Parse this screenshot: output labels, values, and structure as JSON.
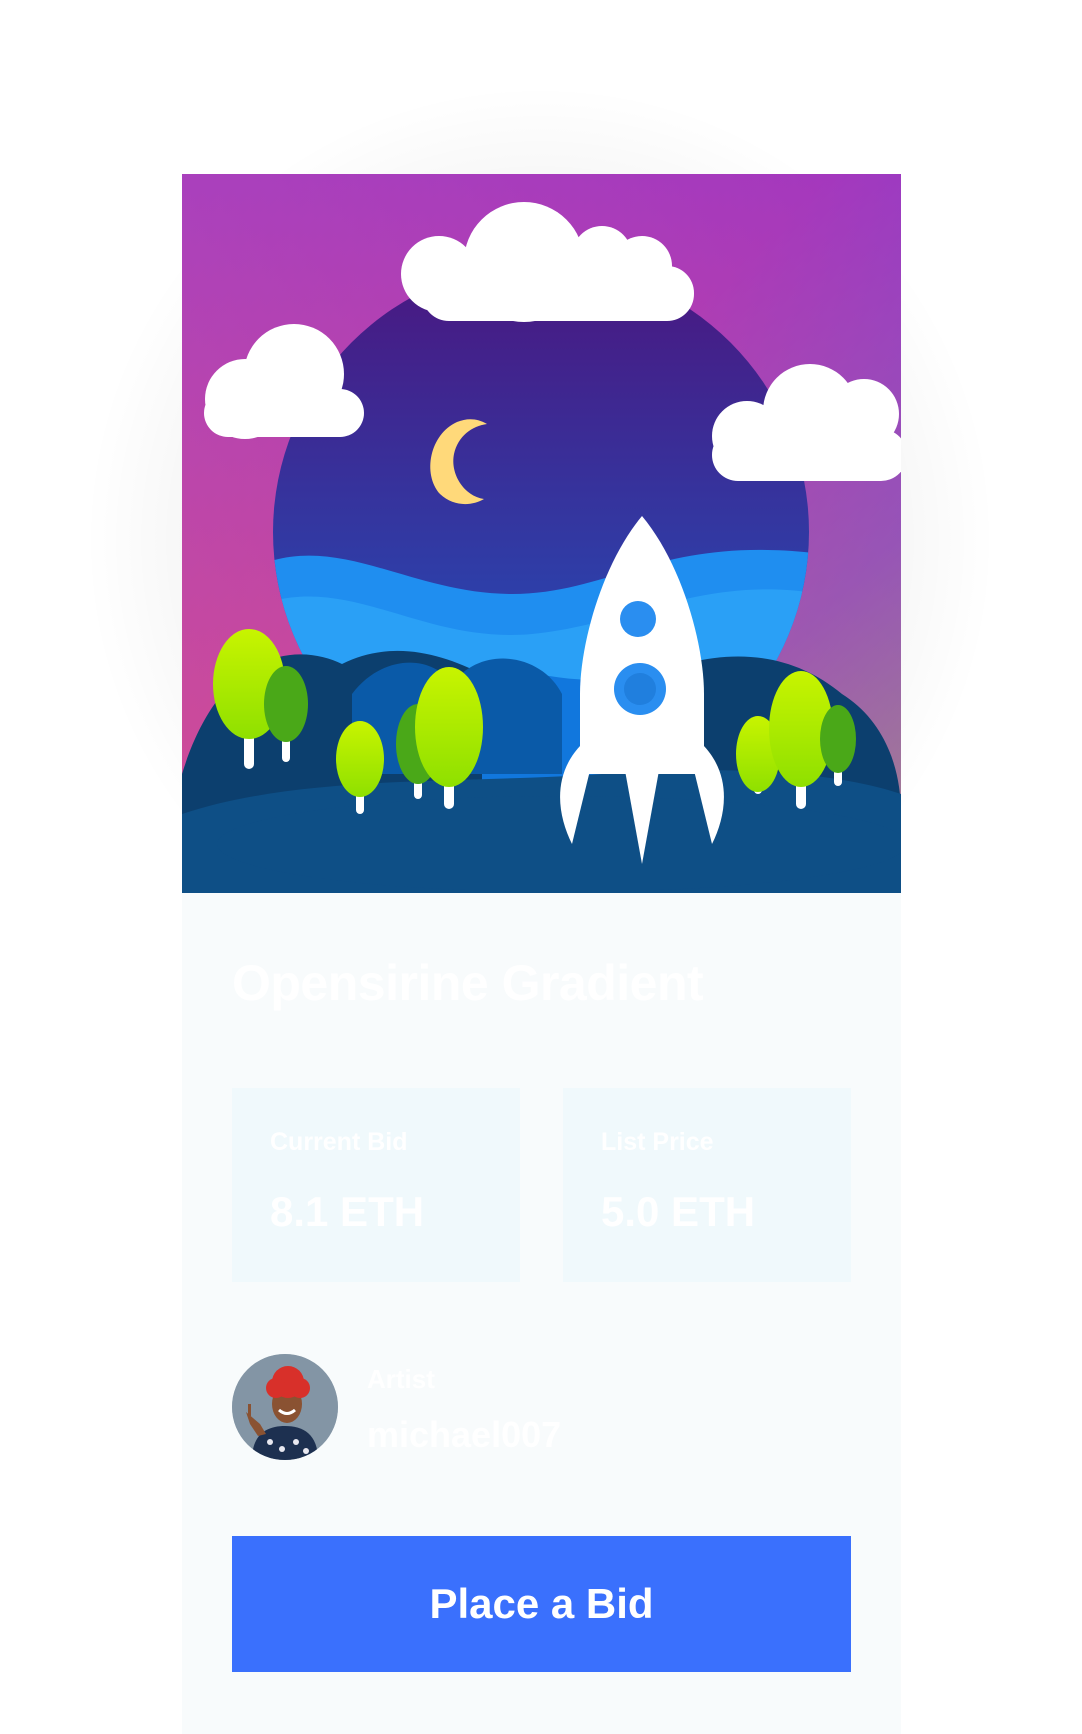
{
  "card": {
    "title": "Opensirine Gradient",
    "artwork_icon": "rocket-landscape-illustration",
    "current_bid": {
      "label": "Current Bid",
      "value": "8.1 ETH"
    },
    "list_price": {
      "label": "List Price",
      "value": "5.0 ETH"
    },
    "artist": {
      "label": "Artist",
      "name": "michael007",
      "avatar_icon": "artist-avatar-photo"
    },
    "bid_button_label": "Place a Bid"
  },
  "colors": {
    "button": "#3a70fd",
    "card_background": "#f8fbfc",
    "price_box_background": "#f0f9fc",
    "text": "#ffffff"
  }
}
